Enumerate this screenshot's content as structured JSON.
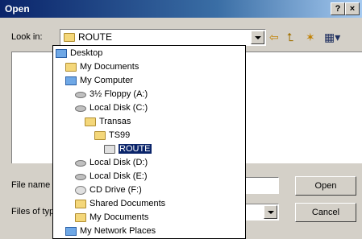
{
  "window": {
    "title": "Open",
    "help": "?",
    "close": "×"
  },
  "lookin": {
    "label": "Look in:",
    "value": "ROUTE"
  },
  "filename": {
    "label": "File name",
    "value": ""
  },
  "filetype": {
    "label": "Files of typ",
    "value": ""
  },
  "buttons": {
    "open": "Open",
    "cancel": "Cancel"
  },
  "toolbar": {
    "back": "⇦",
    "up": "⮤",
    "newfolder": "✶",
    "views": "▦▾"
  },
  "tree": [
    {
      "label": "Desktop",
      "icon": "desktop-icon"
    },
    {
      "label": "My Documents",
      "icon": "folder-icon"
    },
    {
      "label": "My Computer",
      "icon": "computer-icon"
    },
    {
      "label": "3½ Floppy (A:)",
      "icon": "floppy-icon"
    },
    {
      "label": "Local Disk (C:)",
      "icon": "disk-icon"
    },
    {
      "label": "Transas",
      "icon": "folder-icon"
    },
    {
      "label": "TS99",
      "icon": "folder-icon"
    },
    {
      "label": "ROUTE",
      "icon": "folder-open-icon"
    },
    {
      "label": "Local Disk (D:)",
      "icon": "disk-icon"
    },
    {
      "label": "Local Disk (E:)",
      "icon": "disk-icon"
    },
    {
      "label": "CD Drive (F:)",
      "icon": "cd-icon"
    },
    {
      "label": "Shared Documents",
      "icon": "folder-icon"
    },
    {
      "label": "My Documents",
      "icon": "folder-icon"
    },
    {
      "label": "My Network Places",
      "icon": "network-icon"
    }
  ]
}
